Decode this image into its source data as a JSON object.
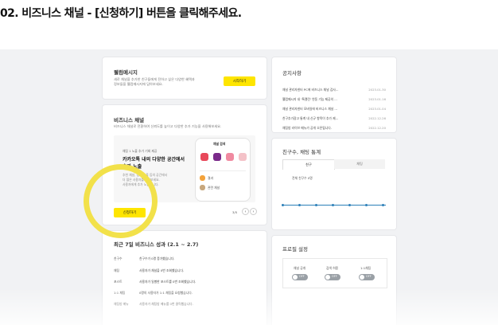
{
  "header": {
    "title": "02. 비즈니스 채널 - [신청하기] 버튼을 클릭해주세요."
  },
  "welcome": {
    "title": "웰컴메시지",
    "desc1": "새로 채널을 추가한 친구들에게 전하고 싶은 다양한 혜택과",
    "desc2": "정보들을 웰컴메시지에 담아보세요.",
    "button": "시작하기"
  },
  "business": {
    "title": "비즈니스 채널",
    "desc": "비즈니스 채널로 전환하여 신뢰도를 높이고 다양한 추가 기능을 사용해보세요.",
    "promo_small": "채팅 1 노출 추가 기회 제공",
    "promo_title1": "카카오톡 내의 다양한 공간에서",
    "promo_title2": "추가 노출",
    "promo_body1": "추천 채널, 검색 노출 등의 공간에서",
    "promo_body2": "더 많은 사용자를 만나보세요.",
    "promo_body3": "사용자에게 추가 노출됩니다.",
    "apply_button": "신청하기",
    "pager_count": "3/5",
    "prev": "‹",
    "next": "›",
    "phone_label": "채널 검색",
    "phone_item1": "결과",
    "phone_item2": "관련 채널"
  },
  "stats_card": {
    "title": "최근 7일 비즈니스 성과 (2.1 ~ 2.7)",
    "rows": [
      {
        "label": "친구수",
        "value": "친구수가 0명 증가했습니다."
      },
      {
        "label": "채팅",
        "value": "사용자가 채널을 0번 조회했습니다."
      },
      {
        "label": "포스트",
        "value": "사용자가 일별한 포스트를 0번 조회했습니다."
      },
      {
        "label": "1:1 채팅",
        "value": "0명의 사용자가 1:1 채팅을 요청했습니다."
      },
      {
        "label": "채팅방 메뉴",
        "value": "사용자가 채팅방 메뉴를 0번 클릭했습니다."
      }
    ]
  },
  "notices": {
    "title": "공지사항",
    "items": [
      {
        "text": "채널 관리자센터 PC에 비즈니스 채널 검사...",
        "date": "2023.01.30"
      },
      {
        "text": "웰컴메시지 내 '톡캘린' 연동 기능 제공의 ...",
        "date": "2023.01.16"
      },
      {
        "text": "채널 관리자센터 모바일에 비즈니스 채널 ...",
        "date": "2023.01.04"
      },
      {
        "text": "친구추가광고 통계 내 신규 항목이 추가 제...",
        "date": "2022.12.26"
      },
      {
        "text": "채팅방 라이브 메뉴가 공개 오픈됩니다.",
        "date": "2022.12.20"
      }
    ]
  },
  "friend_stats": {
    "title": "친구수, 채팅 통계",
    "tab_friends": "친구",
    "tab_chat": "채팅",
    "label": "전체 친구수 0명"
  },
  "profile": {
    "title": "프로필 설정",
    "toggles": [
      {
        "label": "채널 공개",
        "state": "OFF"
      },
      {
        "label": "검색 허용",
        "state": "OFF"
      },
      {
        "label": "1:1채팅",
        "state": "OFF"
      }
    ]
  }
}
